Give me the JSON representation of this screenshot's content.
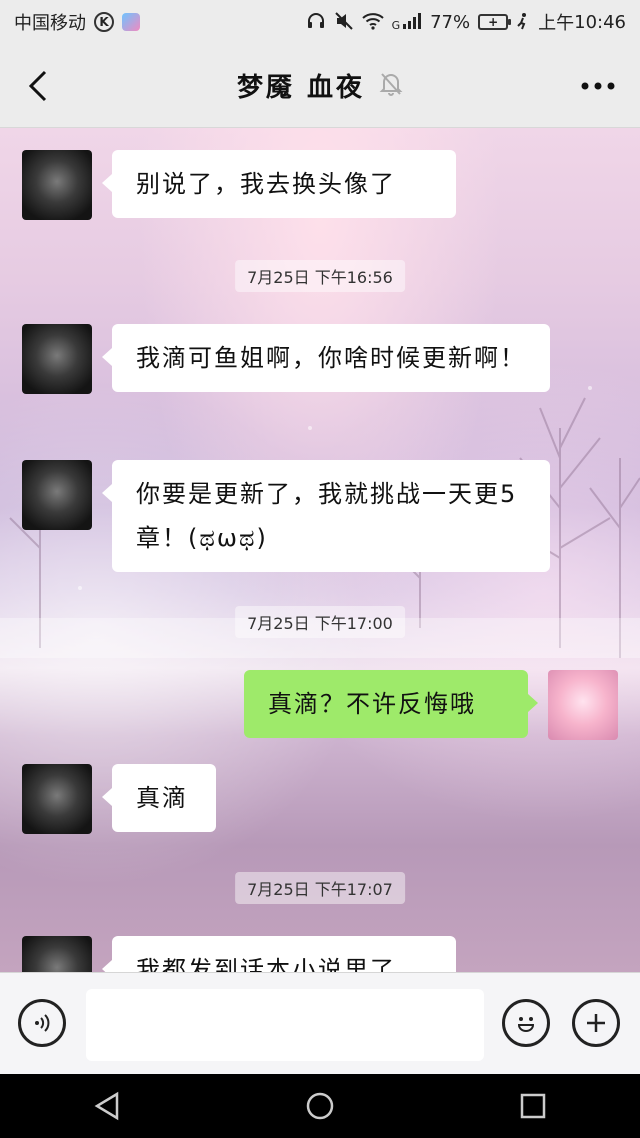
{
  "status_bar": {
    "carrier": "中国移动",
    "k_badge": "K",
    "network_type": "G",
    "battery_level": "77%",
    "time_prefix": "上午",
    "time": "10:46",
    "icons": [
      "headphones-icon",
      "mute-icon",
      "wifi-icon",
      "signal-icon",
      "battery-icon"
    ]
  },
  "header": {
    "title": "梦魇 血夜",
    "muted_icon": "bell-off-icon",
    "back_icon": "back-arrow-icon",
    "more_icon": "more-dots-icon"
  },
  "messages": [
    {
      "side": "left",
      "text": "别说了，我去换头像了"
    },
    {
      "type": "time",
      "text": "7月25日 下午16:56"
    },
    {
      "side": "left",
      "text": "我滴可鱼姐啊，你啥时候更新啊！"
    },
    {
      "side": "left",
      "text": "你要是更新了，我就挑战一天更5章！(ಥωಥ)"
    },
    {
      "type": "time",
      "text": "7月25日 下午17:00"
    },
    {
      "side": "right",
      "text": "真滴？不许反悔哦"
    },
    {
      "side": "left",
      "text": "真滴"
    },
    {
      "type": "time",
      "text": "7月25日 下午17:07"
    },
    {
      "side": "left",
      "text": "我都发到话本小说里了"
    }
  ],
  "input_bar": {
    "placeholder": "",
    "value": "",
    "voice_icon": "voice-icon",
    "emoji_icon": "emoji-icon",
    "plus_icon": "plus-icon"
  },
  "nav_bar": {
    "back_icon": "nav-back-icon",
    "home_icon": "nav-home-icon",
    "recent_icon": "nav-recent-icon"
  },
  "colors": {
    "header_bg": "#ececec",
    "bubble_self": "#9eea6a",
    "bubble_other": "#ffffff"
  }
}
